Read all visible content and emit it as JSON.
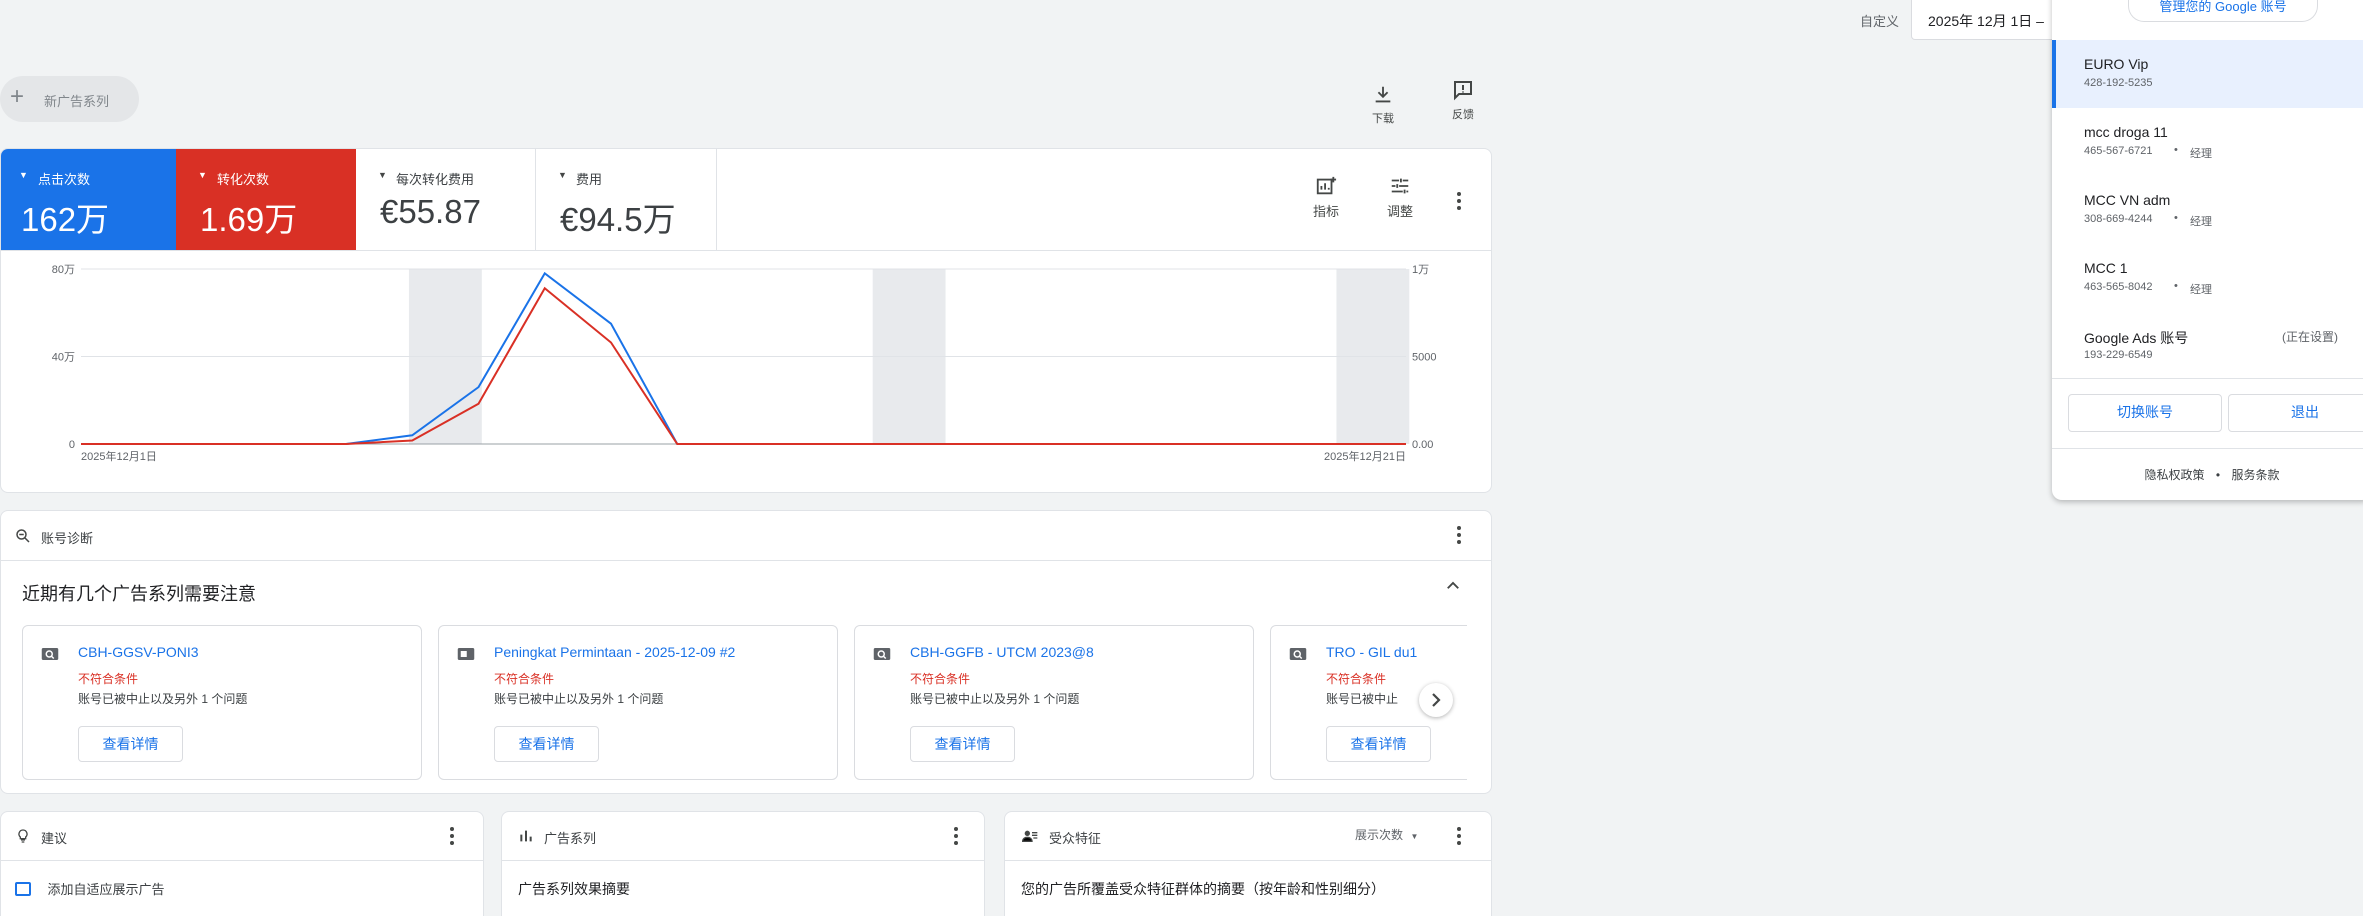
{
  "header": {
    "date_label": "自定义",
    "date_value": "2025年 12月 1日 –",
    "new_campaign": "新广告系列",
    "download": "下载",
    "feedback": "反馈"
  },
  "metrics": [
    {
      "label": "点击次数",
      "value": "162万",
      "color": "#1a73e8"
    },
    {
      "label": "转化次数",
      "value": "1.69万",
      "color": "#d93025"
    },
    {
      "label": "每次转化费用",
      "value": "€55.87"
    },
    {
      "label": "费用",
      "value": "€94.5万"
    }
  ],
  "chart_tools": {
    "metrics": "指标",
    "adjust": "调整"
  },
  "chart_data": {
    "type": "line",
    "x": [
      "2025-12-01",
      "2025-12-02",
      "2025-12-03",
      "2025-12-04",
      "2025-12-05",
      "2025-12-06",
      "2025-12-07",
      "2025-12-08",
      "2025-12-09",
      "2025-12-10",
      "2025-12-11",
      "2025-12-12",
      "2025-12-13",
      "2025-12-14",
      "2025-12-15",
      "2025-12-16",
      "2025-12-17",
      "2025-12-18",
      "2025-12-19",
      "2025-12-20",
      "2025-12-21"
    ],
    "x_tick_labels": [
      "2025年12月1日",
      "2025年12月21日"
    ],
    "series": [
      {
        "name": "点击次数",
        "axis": "left",
        "color": "#1a73e8",
        "values": [
          0,
          0,
          0,
          0,
          0,
          4,
          26,
          78,
          55,
          0,
          0,
          0,
          0,
          0,
          0,
          0,
          0,
          0,
          0,
          0,
          0
        ]
      },
      {
        "name": "转化次数",
        "axis": "right",
        "color": "#d93025",
        "values": [
          0,
          0,
          0,
          0,
          0,
          200,
          2300,
          8900,
          5800,
          0,
          0,
          0,
          0,
          0,
          0,
          0,
          0,
          0,
          0,
          0,
          0
        ]
      }
    ],
    "left_axis": {
      "ticks": [
        "0",
        "40万",
        "80万"
      ],
      "max": 80
    },
    "right_axis": {
      "ticks": [
        "0.00",
        "5000",
        "1万"
      ],
      "max": 10000
    },
    "weekend_bands": [
      [
        5,
        6
      ],
      [
        12,
        13
      ],
      [
        19,
        20
      ]
    ]
  },
  "diagnostics": {
    "title": "账号诊断",
    "heading": "近期有几个广告系列需要注意",
    "cards": [
      {
        "name": "CBH-GGSV-PONI3",
        "status": "不符合条件",
        "desc": "账号已被中止以及另外 1 个问题",
        "button": "查看详情",
        "icon": "search-icon"
      },
      {
        "name": "Peningkat Permintaan - 2025-12-09 #2",
        "status": "不符合条件",
        "desc": "账号已被中止以及另外 1 个问题",
        "button": "查看详情",
        "icon": "display-icon"
      },
      {
        "name": "CBH-GGFB - UTCM 2023@8",
        "status": "不符合条件",
        "desc": "账号已被中止以及另外 1 个问题",
        "button": "查看详情",
        "icon": "search-icon"
      },
      {
        "name": "TRO - GIL du1",
        "status": "不符合条件",
        "desc": "账号已被中止",
        "button": "查看详情",
        "icon": "search-icon"
      }
    ]
  },
  "bottom": {
    "suggestions": {
      "title": "建议",
      "item": "添加自适应展示广告"
    },
    "campaigns": {
      "title": "广告系列",
      "subtitle": "广告系列效果摘要"
    },
    "audience": {
      "title": "受众特征",
      "dropdown": "展示次数",
      "subtitle": "您的广告所覆盖受众特征群体的摘要（按年龄和性别细分）"
    }
  },
  "account_panel": {
    "manage": "管理您的 Google 账号",
    "accounts": [
      {
        "name": "EURO Vip",
        "id": "428-192-5235",
        "role": "",
        "status": ""
      },
      {
        "name": "mcc droga 11",
        "id": "465-567-6721",
        "role": "经理",
        "status": ""
      },
      {
        "name": "MCC VN adm",
        "id": "308-669-4244",
        "role": "经理",
        "status": ""
      },
      {
        "name": "MCC 1",
        "id": "463-565-8042",
        "role": "经理",
        "status": ""
      },
      {
        "name": "Google Ads 账号",
        "id": "193-229-6549",
        "role": "",
        "status": "(正在设置)"
      }
    ],
    "switch": "切换账号",
    "signout": "退出",
    "privacy": "隐私权政策",
    "terms": "服务条款"
  }
}
